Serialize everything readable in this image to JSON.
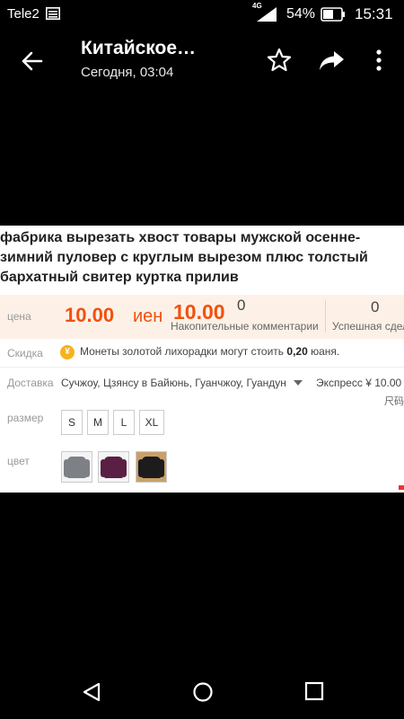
{
  "status_bar": {
    "carrier": "Tele2",
    "network": "4G",
    "battery": "54%",
    "time": "15:31",
    "icons": [
      "sim-card-icon",
      "signal-icon",
      "battery-icon"
    ]
  },
  "app_bar": {
    "title": "Китайское…",
    "subtitle": "Сегодня, 03:04",
    "icons": [
      "back-arrow-icon",
      "star-icon",
      "share-icon",
      "more-vertical-icon"
    ]
  },
  "product": {
    "title": "фабрика вырезать хвост товары мужской осенне-зимний пуловер с круглым вырезом плюс толстый бархатный свитер куртка прилив",
    "price": {
      "label": "цена",
      "main": "10.00",
      "currency": "иен",
      "second": "10.00"
    },
    "comments": {
      "count": "0",
      "label": "Накопительные комментарии"
    },
    "deals": {
      "count": "0",
      "label": "Успешная сделка"
    },
    "discount": {
      "label": "Скидка",
      "coin": "¥",
      "text_before": "Монеты золотой лихорадки могут стоить ",
      "amount": "0,20",
      "text_after": " юаня."
    },
    "delivery": {
      "label": "Доставка",
      "from": "Сучжоу, Цзянсу в Байюнь, Гуанчжоу, Гуандун",
      "method": "Экспресс ¥ 10.00",
      "size_hint": "尺码"
    },
    "size": {
      "label": "размер",
      "options": [
        "S",
        "M",
        "L",
        "XL"
      ]
    },
    "color": {
      "label": "цвет",
      "swatches": [
        {
          "name": "gray",
          "color": "#7d8085"
        },
        {
          "name": "purple",
          "color": "#5a1f45"
        },
        {
          "name": "black",
          "color": "#1c1c1c"
        }
      ]
    }
  },
  "colors": {
    "accent_price": "#f2500f",
    "price_row_bg": "#fdf1e7",
    "coin": "#f7b31b"
  },
  "nav_bar": {
    "icons": [
      "nav-back-icon",
      "nav-home-icon",
      "nav-recent-icon"
    ]
  }
}
